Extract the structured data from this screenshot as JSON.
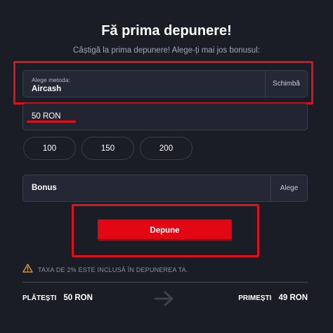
{
  "header": {
    "title": "Fă prima depunere!",
    "subtitle": "Câștigă la prima depunere! Alege-ți mai jos bonusul:"
  },
  "payment_method": {
    "label": "Alege metoda:",
    "value": "Aircash",
    "change_label": "Schimbă"
  },
  "amount": {
    "value": "50 RON",
    "presets": [
      "100",
      "150",
      "200"
    ]
  },
  "bonus": {
    "label": "Bonus",
    "choose_label": "Alege"
  },
  "submit": {
    "label": "Depune"
  },
  "fee_notice": {
    "icon": "warning-icon",
    "text": "TAXA DE 2% ESTE INCLUSĂ ÎN DEPUNEREA TA."
  },
  "summary": {
    "pay_label": "PLĂTEȘTI",
    "pay_value": "50 RON",
    "receive_label": "PRIMEȘTI",
    "receive_value": "49 RON",
    "arrow_icon": "arrow-right-icon"
  },
  "colors": {
    "background": "#1b1d26",
    "accent": "#e30613",
    "highlight_outline": "#e0101a",
    "field_bg": "#242734",
    "warning": "#f0a020"
  }
}
